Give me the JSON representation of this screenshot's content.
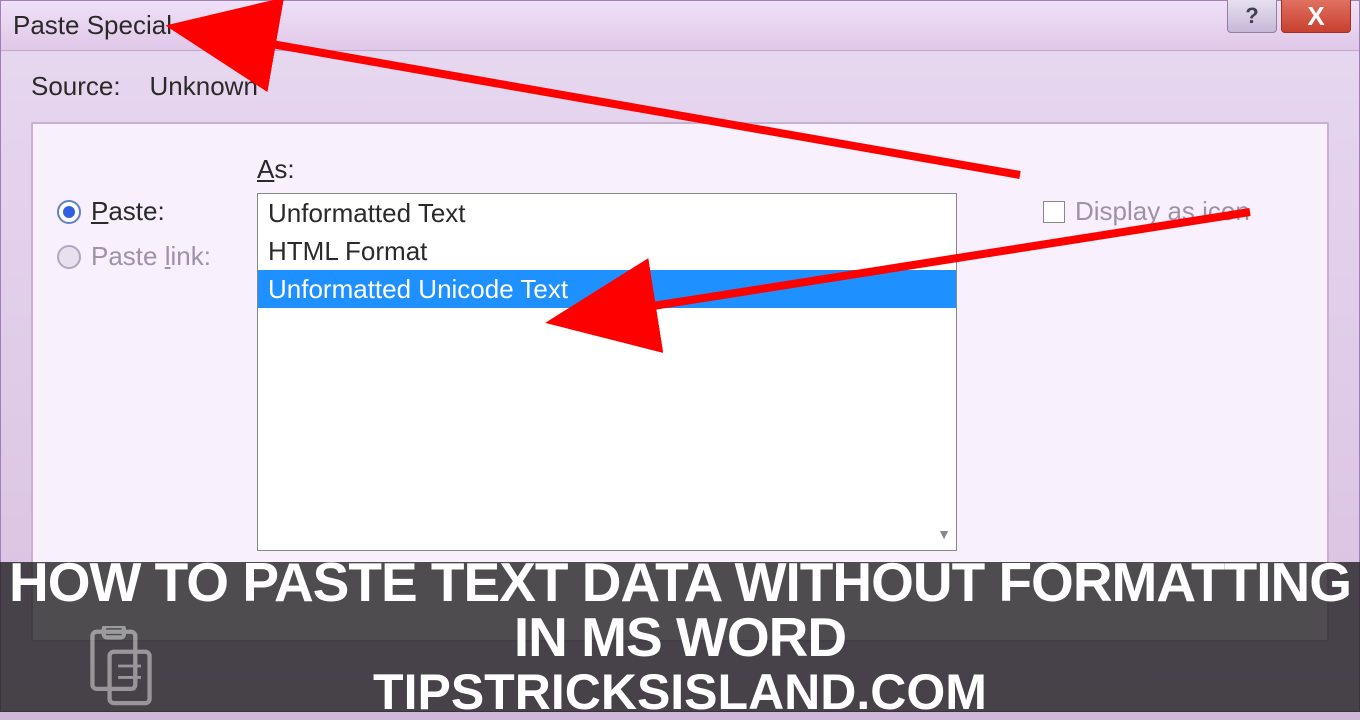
{
  "dialog": {
    "title": "Paste Special",
    "source_label": "Source:",
    "source_value": "Unknown"
  },
  "options": {
    "paste_label": "Paste:",
    "paste_link_label": "Paste link:",
    "as_label": "As:",
    "display_icon_label": "Display as icon"
  },
  "listbox": {
    "items": [
      "Unformatted Text",
      "HTML Format",
      "Unformatted Unicode Text"
    ]
  },
  "banner": {
    "title": "HOW TO PASTE TEXT DATA WITHOUT FORMATTING IN MS WORD",
    "subtitle": "TIPSTRICKSISLAND.COM"
  },
  "controls": {
    "help": "?",
    "close": "X"
  }
}
